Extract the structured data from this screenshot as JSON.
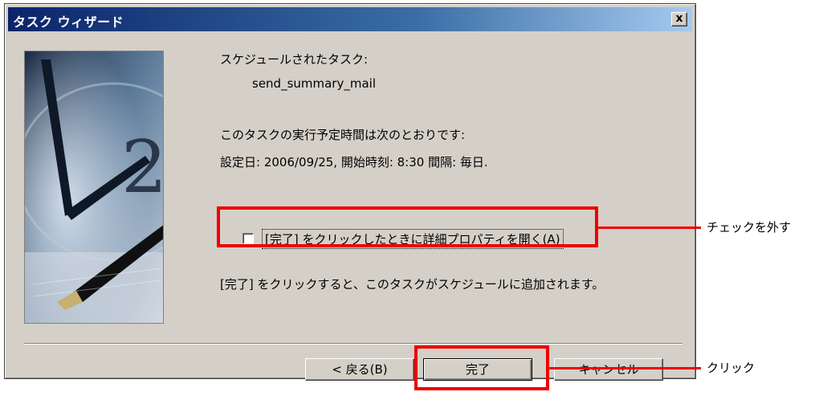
{
  "window": {
    "title": "タスク ウィザード",
    "close_glyph": "x"
  },
  "content": {
    "scheduled_task_label": "スケジュールされたタスク:",
    "task_name": "send_summary_mail",
    "schedule_intro": "このタスクの実行予定時間は次のとおりです:",
    "schedule_detail": "設定日: 2006/09/25, 開始時刻: 8:30  間隔: 毎日.",
    "checkbox_label": "[完了] をクリックしたときに詳細プロパティを開く(A)",
    "checkbox_checked": false,
    "finish_info": "[完了] をクリックすると、このタスクがスケジュールに追加されます。"
  },
  "buttons": {
    "back": "< 戻る(B)",
    "finish": "完了",
    "cancel": "キャンセル"
  },
  "annotations": {
    "uncheck": "チェックを外す",
    "click": "クリック",
    "highlight_color": "#ee0000"
  }
}
